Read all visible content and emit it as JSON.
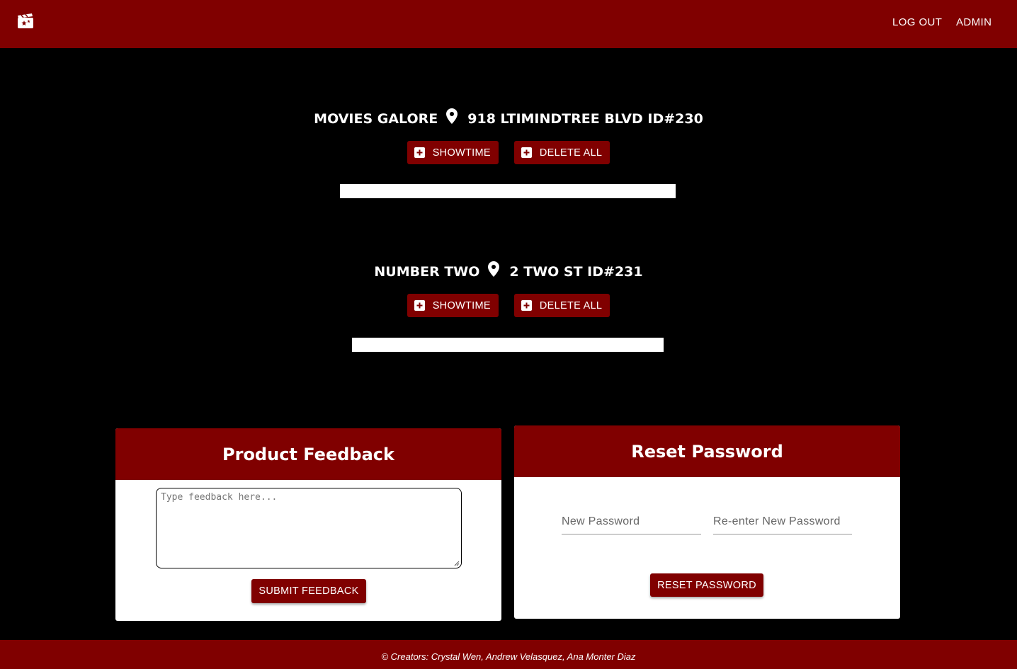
{
  "app": {
    "logo_icon": "clapperboard-icon",
    "brand_color": "#800000"
  },
  "nav": {
    "logout_label": "LOG OUT",
    "admin_label": "ADMIN"
  },
  "theaters": [
    {
      "name": "MOVIES GALORE",
      "address": "918 LTIMINDTREE BLVD ID#230",
      "showtime_label": "SHOWTIME",
      "delete_label": "DELETE ALL"
    },
    {
      "name": "NUMBER TWO",
      "address": "2 TWO ST ID#231",
      "showtime_label": "SHOWTIME",
      "delete_label": "DELETE ALL"
    }
  ],
  "feedback": {
    "title": "Product Feedback",
    "placeholder": "Type feedback here...",
    "submit_label": "SUBMIT FEEDBACK"
  },
  "reset": {
    "title": "Reset Password",
    "new_placeholder": "New Password",
    "reenter_placeholder": "Re-enter New Password",
    "button_label": "RESET PASSWORD"
  },
  "footer": {
    "text": "© Creators: Crystal Wen, Andrew Velasquez, Ana Monter Diaz"
  }
}
